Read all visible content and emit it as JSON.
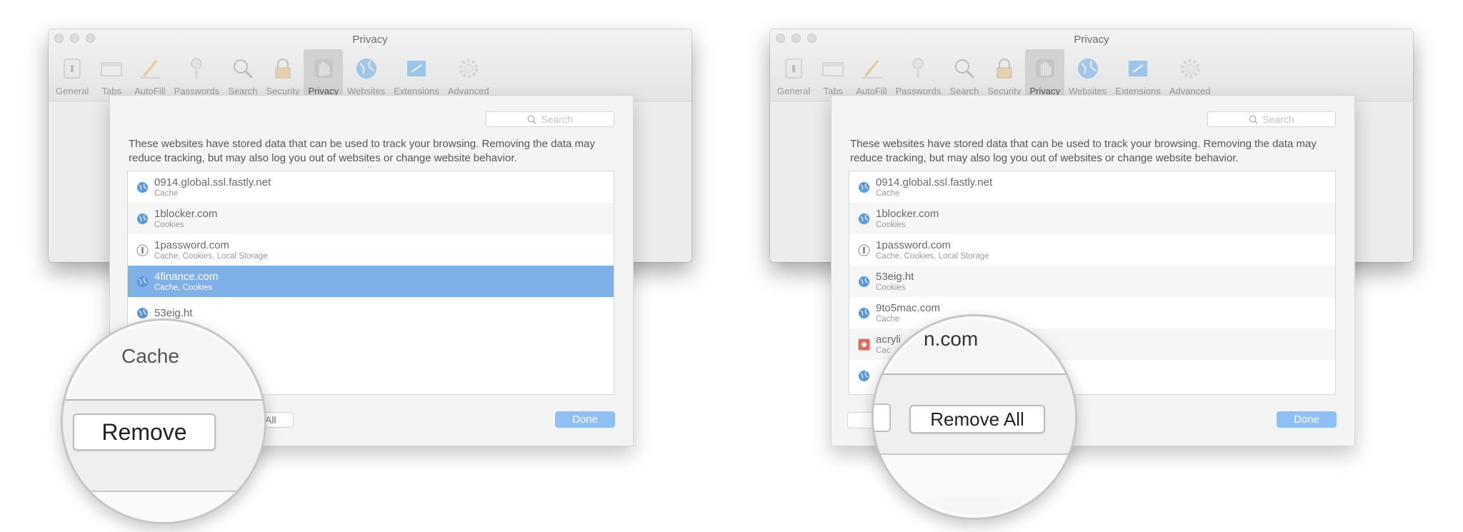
{
  "window": {
    "title": "Privacy",
    "toolbar": [
      {
        "label": "General",
        "icon": "general-icon"
      },
      {
        "label": "Tabs",
        "icon": "tabs-icon"
      },
      {
        "label": "AutoFill",
        "icon": "autofill-icon"
      },
      {
        "label": "Passwords",
        "icon": "key-icon"
      },
      {
        "label": "Search",
        "icon": "search-icon"
      },
      {
        "label": "Security",
        "icon": "lock-icon"
      },
      {
        "label": "Privacy",
        "icon": "hand-icon"
      },
      {
        "label": "Websites",
        "icon": "globe-icon"
      },
      {
        "label": "Extensions",
        "icon": "puzzle-icon"
      },
      {
        "label": "Advanced",
        "icon": "gear-icon"
      }
    ],
    "help": "?"
  },
  "sheet": {
    "search_placeholder": "Search",
    "description": "These websites have stored data that can be used to track your browsing. Removing the data may reduce tracking, but may also log you out of websites or change website behavior.",
    "done_label": "Done"
  },
  "left": {
    "sites": [
      {
        "name": "0914.global.ssl.fastly.net",
        "detail": "Cache",
        "icon": "globe-icon"
      },
      {
        "name": "1blocker.com",
        "detail": "Cookies",
        "icon": "globe-icon"
      },
      {
        "name": "1password.com",
        "detail": "Cache, Cookies, Local Storage",
        "icon": "1password-icon"
      },
      {
        "name": "4finance.com",
        "detail": "Cache, Cookies",
        "icon": "globe-icon",
        "selected": true
      },
      {
        "name": "53eig.ht",
        "detail": "",
        "icon": "globe-icon"
      }
    ],
    "remove_all_partial": "All",
    "loupe": {
      "top_text": "Cache",
      "button": "Remove"
    }
  },
  "right": {
    "sites": [
      {
        "name": "0914.global.ssl.fastly.net",
        "detail": "Cache",
        "icon": "globe-icon"
      },
      {
        "name": "1blocker.com",
        "detail": "Cookies",
        "icon": "globe-icon"
      },
      {
        "name": "1password.com",
        "detail": "Cache, Cookies, Local Storage",
        "icon": "1password-icon"
      },
      {
        "name": "53eig.ht",
        "detail": "Cookies",
        "icon": "globe-icon"
      },
      {
        "name": "9to5mac.com",
        "detail": "Cache",
        "icon": "globe-icon"
      },
      {
        "name": "acryli",
        "detail": "Cac",
        "icon": "app-icon"
      },
      {
        "name": "",
        "detail": "",
        "icon": "globe-icon"
      }
    ],
    "loupe": {
      "top_text": "n.com",
      "button": "Remove All"
    }
  },
  "colors": {
    "selection": "#80b0e8",
    "done_button": "#8fbff3",
    "window_bg": "#ececec"
  }
}
